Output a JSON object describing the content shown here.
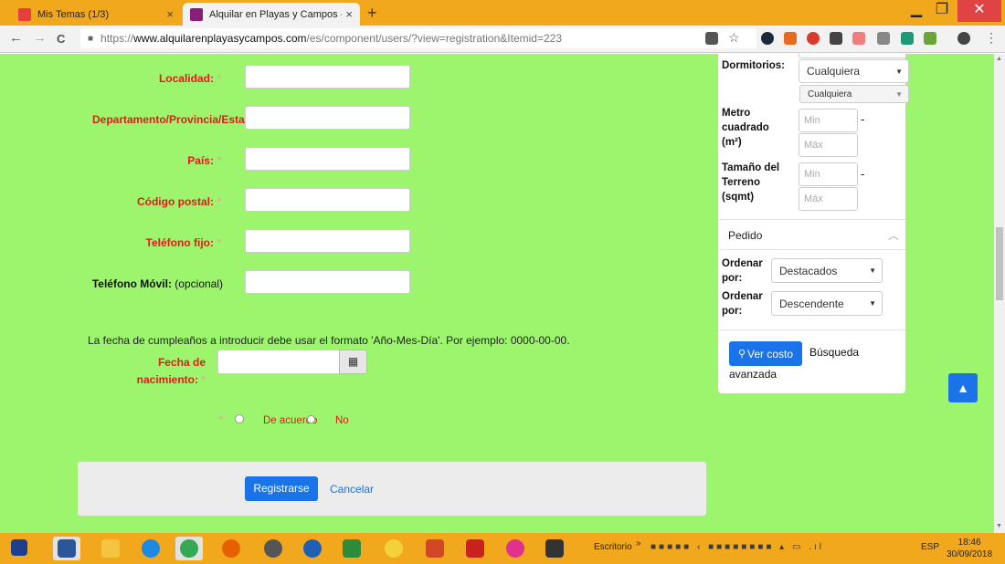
{
  "browser": {
    "tabs": [
      {
        "label": "Mis Temas (1/3)",
        "fav_color": "#e63d3d"
      },
      {
        "label": "Alquilar en Playas y Campos - Al",
        "fav_color": "#8a1c7a"
      }
    ],
    "new_tab": "+",
    "window": {
      "minimize": "▁",
      "maximize": "❐",
      "close": "✕"
    },
    "nav": {
      "back": "←",
      "forward": "→",
      "reload": "C"
    },
    "url": {
      "scheme": "https://",
      "host": "www.alquilarenplayasycampos.com",
      "path": "/es/component/users/?view=registration&Itemid=223"
    },
    "star": "☆",
    "menu": "⋮"
  },
  "form": {
    "localidad": {
      "label": "Localidad:",
      "star": " *"
    },
    "departamento": {
      "label": "Departamento/Provincia/Estad",
      "star": ""
    },
    "pais": {
      "label": "País:",
      "star": " *"
    },
    "codigo_postal": {
      "label": "Código postal:",
      "star": " *"
    },
    "telefono_fijo": {
      "label": "Teléfono fijo:",
      "star": " *"
    },
    "telefono_movil": {
      "label": "Teléfono Móvil:",
      "optional": " (opcional)"
    },
    "date_note": "La fecha de cumpleaños a introducir debe usar el formato 'Año-Mes-Día'. Por ejemplo: 0000-00-00.",
    "fecha": {
      "label_line1": "Fecha de",
      "label_line2": "nacimiento:",
      "star": " *",
      "calendar_icon": "▦"
    },
    "terms": {
      "star": "*",
      "agree": "De acuerdo",
      "disagree": "No"
    },
    "submit": "Registrarse",
    "cancel": "Cancelar"
  },
  "panel": {
    "dormitorios": {
      "label": "Dormitorios:",
      "select1": "Cualquiera",
      "select2": "Cualquiera"
    },
    "metro": {
      "label_l1": "Metro",
      "label_l2": "cuadrado",
      "label_l3": "(m²)",
      "min": "Min",
      "max": "Máx"
    },
    "terreno": {
      "label_l1": "Tamaño del",
      "label_l2": "Terreno",
      "label_l3": "(sqmt)",
      "min": "Min",
      "max": "Máx"
    },
    "pedido": "Pedido",
    "ordenar1": {
      "label_l1": "Ordenar",
      "label_l2": "por:",
      "value": "Destacados"
    },
    "ordenar2": {
      "label_l1": "Ordenar",
      "label_l2": "por:",
      "value": "Descendente"
    },
    "ver_costo": "Ver costo",
    "busqueda_l1": "Búsqueda",
    "busqueda_l2": "avanzada"
  },
  "taskbar": {
    "desktop_label": "Escritorio",
    "language": "ESP",
    "time": "18:46",
    "date": "30/09/2018"
  },
  "colors": {
    "page_bg": "#9cf56d",
    "accent": "#1a73e8",
    "required_label": "#e31b1b",
    "chrome_frame": "#f2a81d"
  }
}
